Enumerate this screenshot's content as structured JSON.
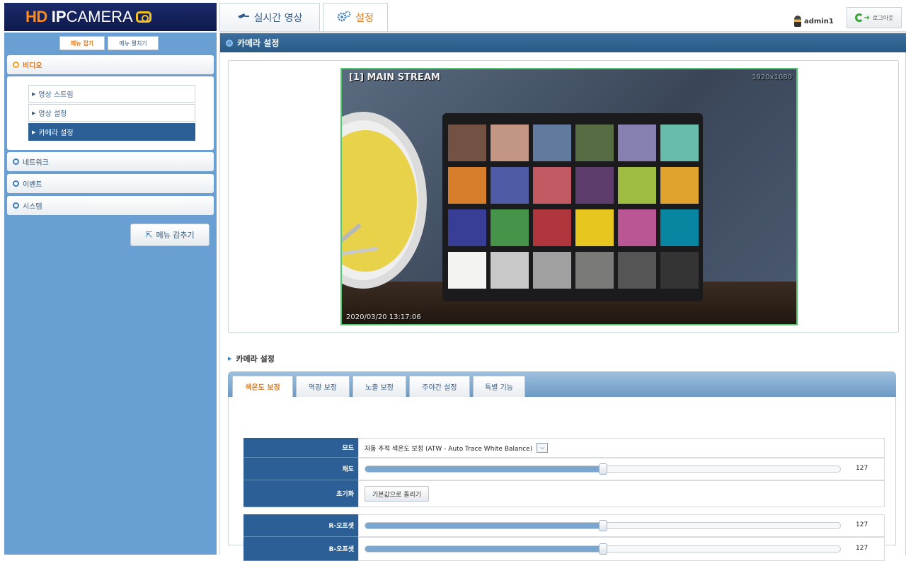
{
  "logo": {
    "hd": "HD",
    "ip": "IP",
    "camera": "CAMERA"
  },
  "top_tabs": [
    {
      "label": "실시간 영상",
      "icon": "camera-icon",
      "active": false
    },
    {
      "label": "설정",
      "icon": "gear-icon",
      "active": true
    }
  ],
  "user": {
    "name": "admin1"
  },
  "logout_label": "로그아웃",
  "sidebar": {
    "open_all": "메뉴 접기",
    "close_all": "메뉴 펼치기",
    "categories": [
      {
        "label": "비디오",
        "items": [
          "영상 스트림",
          "영상 설정",
          "카메라 설정"
        ],
        "active_item": 2
      },
      {
        "label": "네트워크"
      },
      {
        "label": "이벤트"
      },
      {
        "label": "시스템"
      }
    ],
    "hide_menu": "메뉴 감추기"
  },
  "main": {
    "title": "카메라 설정",
    "video": {
      "stream_label": "[1] MAIN STREAM",
      "resolution": "1920x1080",
      "timestamp": "2020/03/20 13:17:06"
    },
    "section_title": "카메라 설정",
    "tabs": [
      "색온도 보정",
      "역광 보정",
      "노출 보정",
      "주야간 설정",
      "특별 기능"
    ],
    "active_tab": 0,
    "settings": {
      "mode_label": "모드",
      "mode_value": "자동 추적 색온도 보정 (ATW - Auto Trace White Balance)",
      "saturation_label": "채도",
      "saturation_value": "127",
      "saturation_fraction": 0.5,
      "reset_label": "초기화",
      "reset_button": "기본값으로 돌리기",
      "r_offset_label": "R-오프셋",
      "r_offset_value": "127",
      "r_offset_fraction": 0.5,
      "b_offset_label": "B-오프셋",
      "b_offset_value": "127",
      "b_offset_fraction": 0.5
    }
  },
  "colors": {
    "sidebar_bg": "#6a9fd4",
    "header_bg": "#2a5a86",
    "accent_orange": "#e07a1a",
    "video_border": "#53c86a"
  },
  "color_chart": [
    "#735244",
    "#c29682",
    "#627a9d",
    "#576c43",
    "#8580b1",
    "#67bdaa",
    "#d67e2c",
    "#505ba6",
    "#c15a63",
    "#5e3c6c",
    "#9dbc40",
    "#e0a32e",
    "#383d96",
    "#469449",
    "#af363c",
    "#e7c71f",
    "#bb5695",
    "#0885a1",
    "#f3f3f2",
    "#c8c8c8",
    "#a0a0a0",
    "#7a7a79",
    "#555555",
    "#343434"
  ]
}
